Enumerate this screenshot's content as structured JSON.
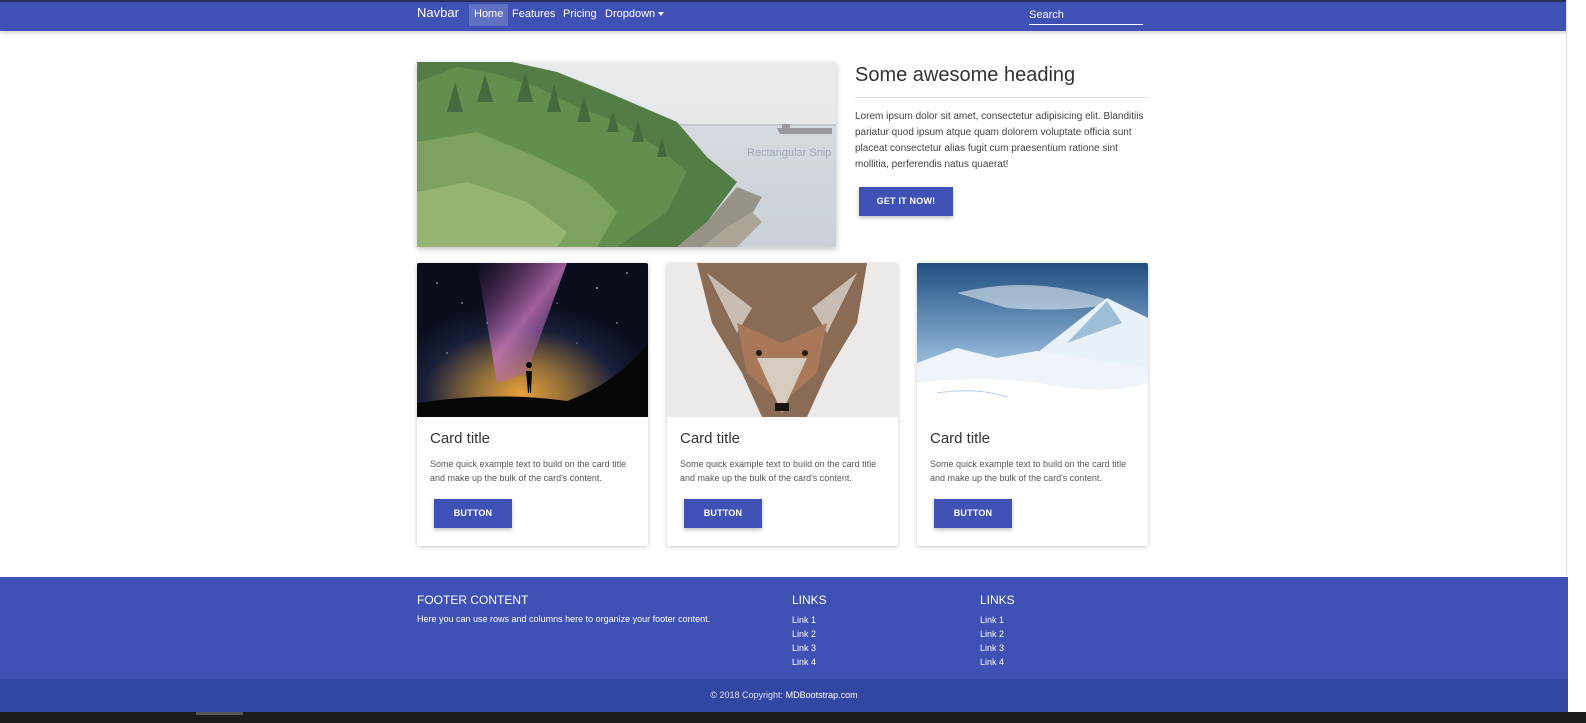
{
  "navbar": {
    "brand": "Navbar",
    "items": [
      {
        "label": "Home",
        "active": true
      },
      {
        "label": "Features"
      },
      {
        "label": "Pricing"
      },
      {
        "label": "Dropdown"
      }
    ],
    "search_placeholder": "Search"
  },
  "hero": {
    "overlay_text": "Rectangular Snip",
    "heading": "Some awesome heading",
    "text": "Lorem ipsum dolor sit amet, consectetur adipisicing elit. Blanditiis pariatur quod ipsum atque quam dolorem voluptate officia sunt placeat consectetur alias fugit cum praesentium ratione sint mollitia, perferendis natus quaerat!",
    "button": "GET IT NOW!"
  },
  "cards": [
    {
      "title": "Card title",
      "text": "Some quick example text to build on the card title and make up the bulk of the card's content.",
      "button": "BUTTON"
    },
    {
      "title": "Card title",
      "text": "Some quick example text to build on the card title and make up the bulk of the card's content.",
      "button": "BUTTON"
    },
    {
      "title": "Card title",
      "text": "Some quick example text to build on the card title and make up the bulk of the card's content.",
      "button": "BUTTON"
    }
  ],
  "footer": {
    "title": "FOOTER CONTENT",
    "description": "Here you can use rows and columns here to organize your footer content.",
    "columns": [
      {
        "title": "LINKS",
        "links": [
          "Link 1",
          "Link 2",
          "Link 3",
          "Link 4"
        ]
      },
      {
        "title": "LINKS",
        "links": [
          "Link 1",
          "Link 2",
          "Link 3",
          "Link 4"
        ]
      }
    ],
    "copyright_prefix": "© 2018 Copyright:",
    "copyright_link": "MDBootstrap.com"
  },
  "colors": {
    "primary": "#3f51b5",
    "footer_copyright": "#3247a3"
  }
}
